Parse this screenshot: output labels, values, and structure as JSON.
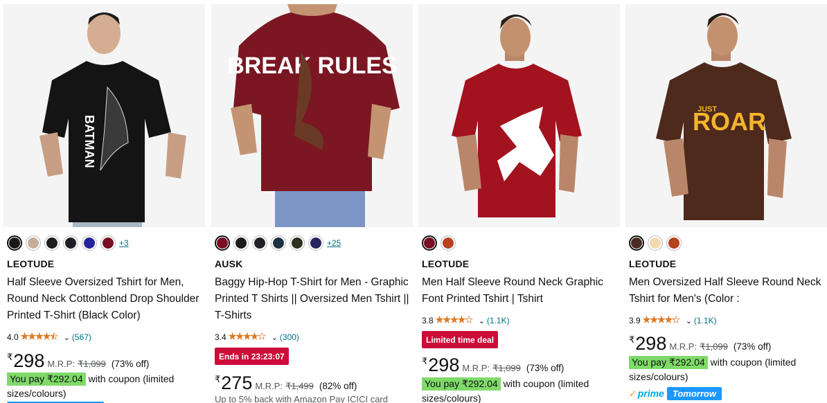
{
  "products": [
    {
      "brand": "LEOTUDE",
      "title": "Half Sleeve Oversized Tshirt for Men, Round Neck Cottonblend Drop Shoulder Printed T-Shirt (Black Color)",
      "swatches": [
        "#1a1a1a",
        "#c8ae9a",
        "#1c1c1c",
        "#1e1e24",
        "#24249a",
        "#7a0e24"
      ],
      "more_colors": "+3",
      "rating": "4.0",
      "rating_value": 4.0,
      "reviews": "(567)",
      "currency": "₹",
      "price": "298",
      "mrp_label": "M.R.P:",
      "mrp": "₹1,099",
      "discount": "(73% off)",
      "you_pay": "You pay ₹292.04",
      "coupon_text": " with coupon (limited sizes/colours)",
      "shirt_color": "#111111",
      "print_text": "BATMAN"
    },
    {
      "brand": "AUSK",
      "title": "Baggy Hip-Hop T-Shirt for Men - Graphic Printed T Shirts || Oversized Men Tshirt || T-Shirts",
      "swatches": [
        "#7a0e24",
        "#1c1c1c",
        "#1f2028",
        "#1e3140",
        "#2d2f1f",
        "#24245e"
      ],
      "more_colors": "+25",
      "rating": "3.4",
      "rating_value": 3.4,
      "reviews": "(300)",
      "deal_badge": "Ends in 23:23:07",
      "currency": "₹",
      "price": "275",
      "mrp_label": "M.R.P:",
      "mrp": "₹1,499",
      "discount": "(82% off)",
      "cashback": "Up to 5% back with Amazon Pay ICICI card",
      "shirt_color": "#7a1722",
      "print_text": "BREAK RULES"
    },
    {
      "brand": "LEOTUDE",
      "title": "Men Half Sleeve Round Neck Graphic Font Printed Tshirt | Tshirt",
      "swatches": [
        "#7a0e24",
        "#b8411e"
      ],
      "rating": "3.8",
      "rating_value": 3.8,
      "reviews": "(1.1K)",
      "deal_badge": "Limited time deal",
      "currency": "₹",
      "price": "298",
      "mrp_label": "M.R.P:",
      "mrp": "₹1,099",
      "discount": "(73% off)",
      "you_pay": "You pay ₹292.04",
      "coupon_text": " with coupon (limited sizes/colours)",
      "shirt_color": "#a3121f"
    },
    {
      "brand": "LEOTUDE",
      "title": "Men Oversized Half Sleeve Round Neck Tshirt for Men's (Color :",
      "swatches": [
        "#4a2a22",
        "#f3d9b0",
        "#b8411e"
      ],
      "rating": "3.9",
      "rating_value": 3.9,
      "reviews": "(1.1K)",
      "currency": "₹",
      "price": "298",
      "mrp_label": "M.R.P:",
      "mrp": "₹1,099",
      "discount": "(73% off)",
      "you_pay": "You pay ₹292.04",
      "coupon_text": " with coupon (limited sizes/colours)",
      "prime_word": "prime",
      "delivery": "Tomorrow",
      "shirt_color": "#4e2a1c",
      "print_small": "JUST",
      "print_text": "ROAR"
    }
  ],
  "star_glyphs": "★★★★★"
}
